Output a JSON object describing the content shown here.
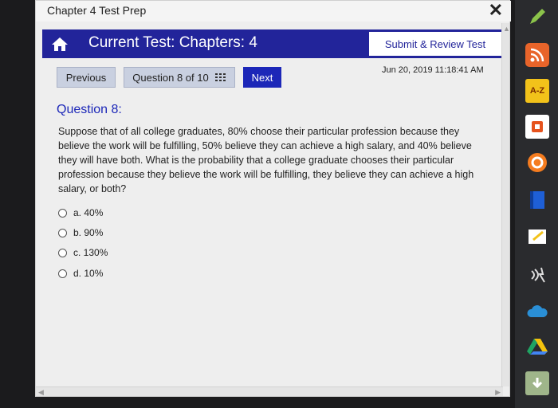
{
  "window": {
    "title": "Chapter 4 Test Prep",
    "close_glyph": "✕"
  },
  "header": {
    "test_title": "Current Test: Chapters: 4",
    "submit_label": "Submit & Review Test"
  },
  "nav": {
    "previous_label": "Previous",
    "question_counter": "Question 8 of 10",
    "next_label": "Next"
  },
  "timestamp": "Jun 20, 2019 11:18:41 AM",
  "question": {
    "heading": "Question 8:",
    "text": "Suppose that of all college graduates, 80% choose their particular profession because they believe the work will be fulfilling, 50% believe they can achieve a high salary, and 40% believe they will have both. What is the probability that a college graduate chooses their particular profession because they believe the work will be fulfilling, they believe they can achieve a high salary, or both?",
    "options": [
      {
        "label": "a. 40%"
      },
      {
        "label": "b. 90%"
      },
      {
        "label": "c. 130%"
      },
      {
        "label": "d. 10%"
      }
    ]
  },
  "dock": {
    "icons": [
      "pencil-icon",
      "rss-icon",
      "dictionary-icon",
      "office-icon",
      "pocket-icon",
      "book-icon",
      "note-icon",
      "voice-icon",
      "cloud-icon",
      "drive-icon",
      "download-icon"
    ],
    "dictionary_label": "A-Z"
  },
  "colors": {
    "header_bg": "#22249a",
    "next_bg": "#1c27b8",
    "question_heading": "#1c27b8"
  }
}
